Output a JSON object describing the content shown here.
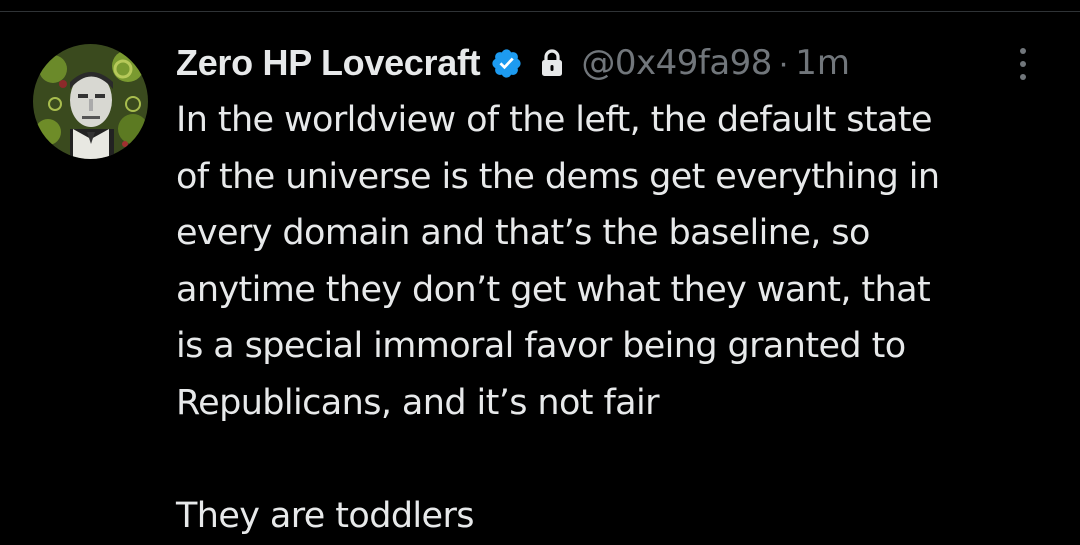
{
  "tweet": {
    "author": {
      "display_name": "Zero HP Lovecraft",
      "handle": "@0x49fa98",
      "verified_icon": "verified-badge-icon",
      "protected_icon": "lock-icon",
      "avatar": "avatar-image"
    },
    "separator": "·",
    "timestamp": "1m",
    "more_icon": "more-options-icon",
    "text_lines": [
      "In the worldview of the left, the default state",
      "of the universe is the dems get everything in",
      "every domain and that’s the baseline, so",
      "anytime they don’t get what they want, that",
      "is a special immoral favor being granted to",
      "Republicans, and it’s not fair",
      "",
      "They are toddlers"
    ]
  },
  "colors": {
    "background": "#000000",
    "text_primary": "#e7e9ea",
    "text_secondary": "#71767b",
    "verified_blue": "#1d9bf0"
  }
}
